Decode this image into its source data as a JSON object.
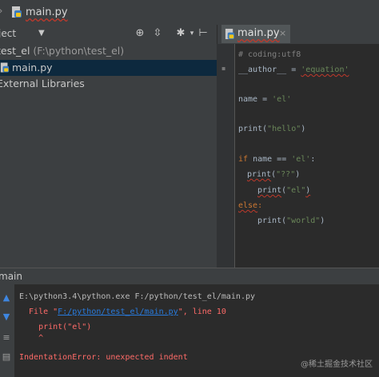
{
  "window": {
    "title": "main.py"
  },
  "project": {
    "panel_label": "ject",
    "tree": [
      {
        "label": "test_el",
        "detail": " (F:\\python\\test_el)"
      },
      {
        "label": "main.py"
      },
      {
        "label": "External Libraries"
      }
    ]
  },
  "editor": {
    "tab_label": "main.py",
    "lines": {
      "l1": "# coding:utf8",
      "l2a": "__author__ = ",
      "l2b": "'equation'",
      "l3a": "name = ",
      "l3b": "'el'",
      "l4a": "print(",
      "l4b": "\"hello\"",
      "l4c": ")",
      "l5a": "if",
      "l5b": " name == ",
      "l5c": "'el'",
      "l5d": ":",
      "l6a": "print",
      "l6b": "(",
      "l6c": "\"??\"",
      "l6d": ")",
      "l7a": "print",
      "l7b": "(",
      "l7c": "\"el\"",
      "l7d": ")",
      "l8a": "else",
      "l8b": ":",
      "l9a": "print(",
      "l9b": "\"world\"",
      "l9c": ")"
    }
  },
  "run": {
    "header_label": "main",
    "console": {
      "cmd": "E:\\python3.4\\python.exe F:/python/test_el/main.py",
      "file_prefix": "  File \"",
      "file_link": "F:/python/test_el/main.py",
      "file_suffix": "\", line 10",
      "code_line": "    print(\"el\")",
      "caret": "    ^",
      "error": "IndentationError: unexpected indent"
    }
  },
  "watermark": "@稀土掘金技术社区",
  "colors": {
    "background": "#2b2b2b",
    "panel": "#3c3f41",
    "keyword": "#cc7832",
    "string": "#6a8759",
    "error_text": "#ff6b68",
    "link": "#287bde",
    "selection": "#0d293e"
  }
}
